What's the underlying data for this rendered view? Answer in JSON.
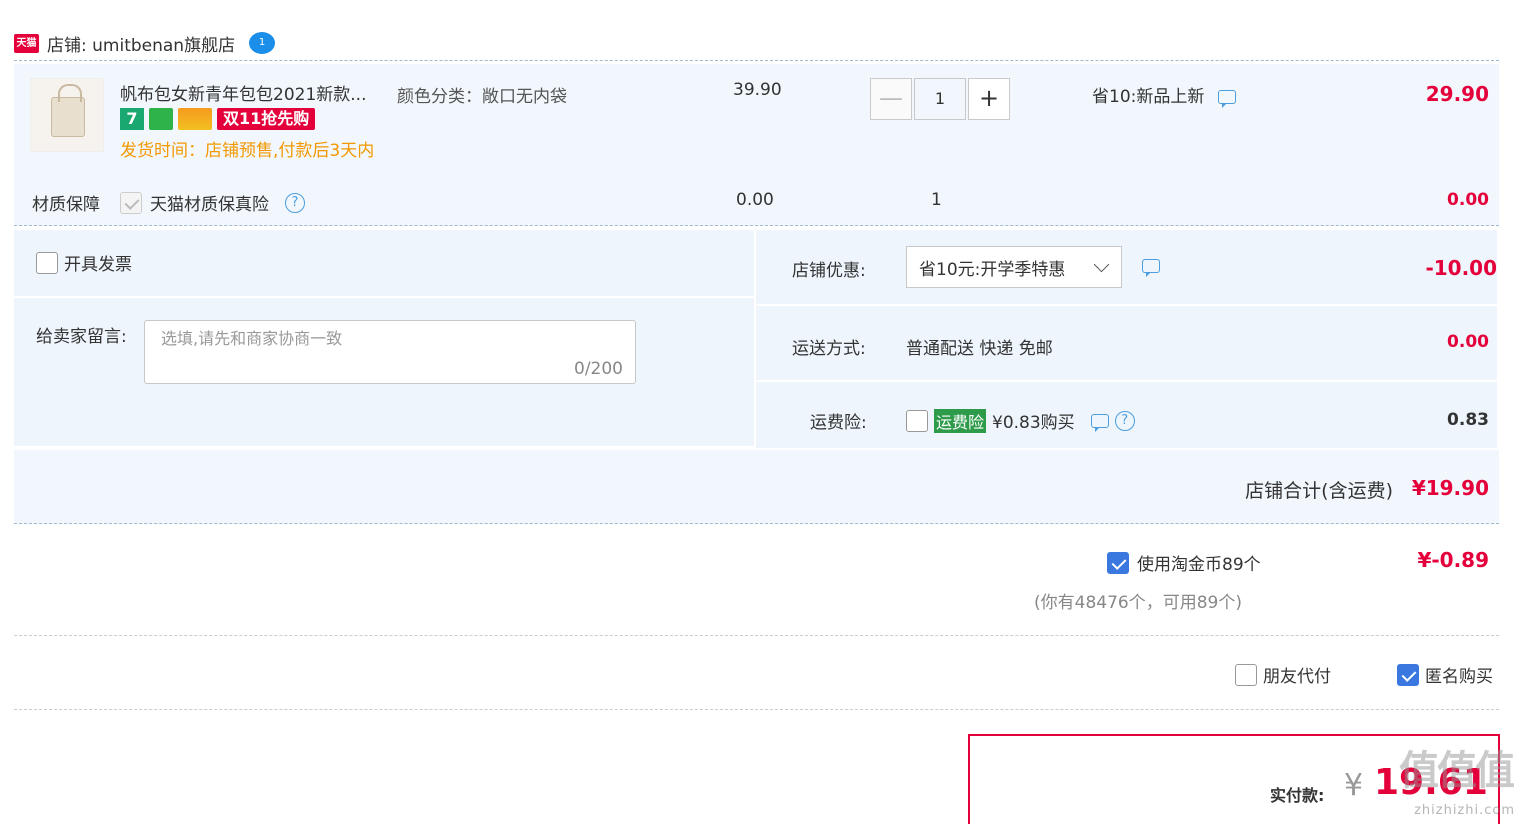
{
  "shop": {
    "logo_text": "天猫",
    "label": "店铺: umitbenan旗舰店",
    "chat_badge": "1"
  },
  "item": {
    "title": "帆布包女新青年包包2021新款...",
    "sku": "颜色分类：敞口无内袋",
    "price": "39.90",
    "quantity": "1",
    "qty_minus": "—",
    "qty_plus": "+",
    "promo": "省10:新品上新",
    "subtotal": "29.90",
    "badge_seven": "7",
    "badge_double11": "双11抢先购",
    "ship_time": "发货时间：店铺预售,付款后3天内"
  },
  "insurance": {
    "label": "材质保障",
    "name": "天猫材质保真险",
    "price": "0.00",
    "quantity": "1",
    "subtotal": "0.00"
  },
  "invoice": {
    "label": "开具发票"
  },
  "message": {
    "label": "给卖家留言:",
    "placeholder": "选填,请先和商家协商一致",
    "counter": "0/200"
  },
  "discount": {
    "label": "店铺优惠:",
    "selected": "省10元:开学季特惠",
    "amount": "-10.00"
  },
  "shipping": {
    "label": "运送方式:",
    "value": "普通配送 快递 免邮",
    "amount": "0.00"
  },
  "freight_insurance": {
    "label": "运费险:",
    "tag": "运费险",
    "text": "¥0.83购买",
    "amount": "0.83"
  },
  "shop_total": {
    "label": "店铺合计(含运费)",
    "amount": "¥19.90"
  },
  "coins": {
    "label": "使用淘金币89个",
    "note": "(你有48476个，可用89个)",
    "amount": "¥-0.89"
  },
  "options": {
    "friend_pay": "朋友代付",
    "anonymous": "匿名购买"
  },
  "pay": {
    "label": "实付款:",
    "currency": "¥",
    "amount": "19.61"
  },
  "watermark": {
    "big": "值值值",
    "small": "zhizhizhi.com"
  }
}
